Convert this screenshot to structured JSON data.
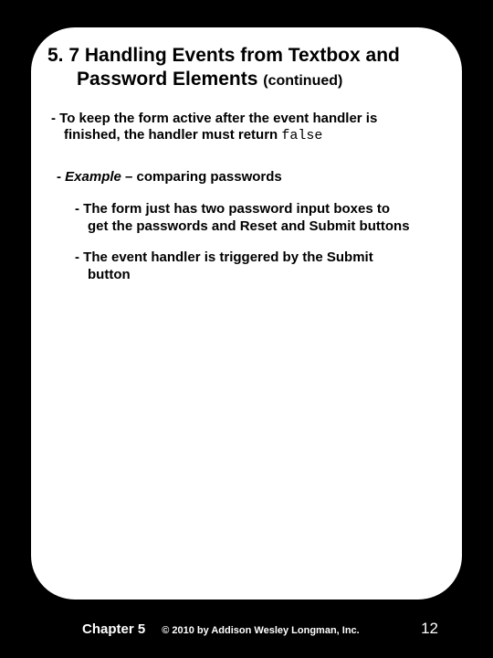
{
  "heading": {
    "line1": "5. 7 Handling Events from Textbox and",
    "line2_main": "Password Elements ",
    "cont": "(continued)"
  },
  "body": {
    "p1_a": "- To keep the form active after the event handler is",
    "p1_b": "finished, the handler must return ",
    "p1_code": "false",
    "p2_a": "- ",
    "p2_em": "Example",
    "p2_b": " – comparing passwords",
    "p3_a": "- The form just has two password input boxes to",
    "p3_b": "get the passwords and Reset and Submit buttons",
    "p4_a": "- The event handler is triggered by the Submit",
    "p4_b": "button"
  },
  "footer": {
    "chapter": "Chapter 5",
    "copyright": "© 2010 by Addison Wesley Longman, Inc.",
    "page": "12"
  }
}
